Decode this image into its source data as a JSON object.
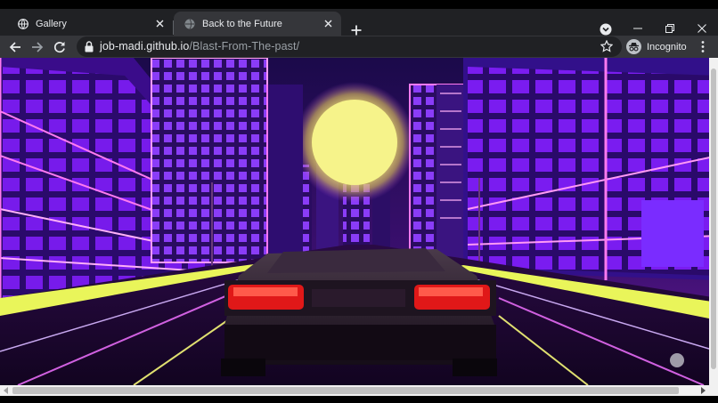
{
  "tabs": [
    {
      "title": "Gallery",
      "active": false
    },
    {
      "title": "Back to the Future",
      "active": true
    }
  ],
  "omnibox": {
    "url_host": "job-madi.github.io",
    "url_path": "/Blast-From-The-past/"
  },
  "profile": {
    "label": "Incognito"
  },
  "icons": {
    "back": "arrow-left-icon",
    "forward": "arrow-right-icon",
    "reload": "reload-icon",
    "lock": "lock-icon",
    "bookmark": "star-icon",
    "menu": "kebab-menu-icon",
    "tab_search": "chevron-down-circle-icon",
    "new_tab": "plus-icon"
  },
  "colors": {
    "sky": "#3a0f6e",
    "sun": "#f3f07a",
    "neon_magenta": "#ff3cf0",
    "neon_yellow": "#e9f55a",
    "building_purple": "#6a10d8",
    "taillight": "#e01818"
  }
}
